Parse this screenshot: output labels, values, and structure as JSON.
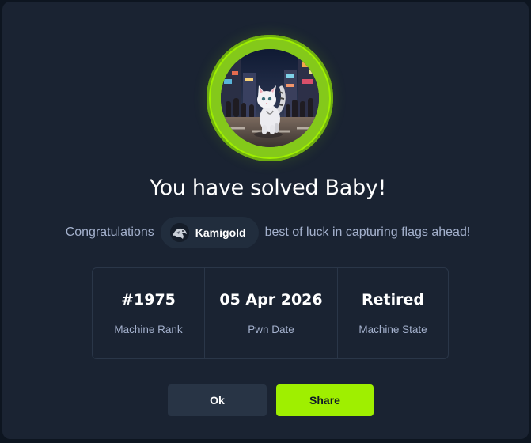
{
  "dialog": {
    "title": "You have solved Baby!",
    "congrats_prefix": "Congratulations",
    "username": "Kamigold",
    "congrats_suffix": "best of luck in capturing flags ahead!"
  },
  "stats": [
    {
      "value": "#1975",
      "label": "Machine Rank"
    },
    {
      "value": "05 Apr 2026",
      "label": "Pwn Date"
    },
    {
      "value": "Retired",
      "label": "Machine State"
    }
  ],
  "buttons": {
    "ok_label": "Ok",
    "share_label": "Share"
  },
  "colors": {
    "accent": "#9fef00",
    "modal_bg": "#1a2332",
    "text_muted": "#a4b1cd"
  },
  "icons": {
    "machine_avatar": "cat-in-city-illustration",
    "user_avatar": "user-avatar-icon"
  }
}
